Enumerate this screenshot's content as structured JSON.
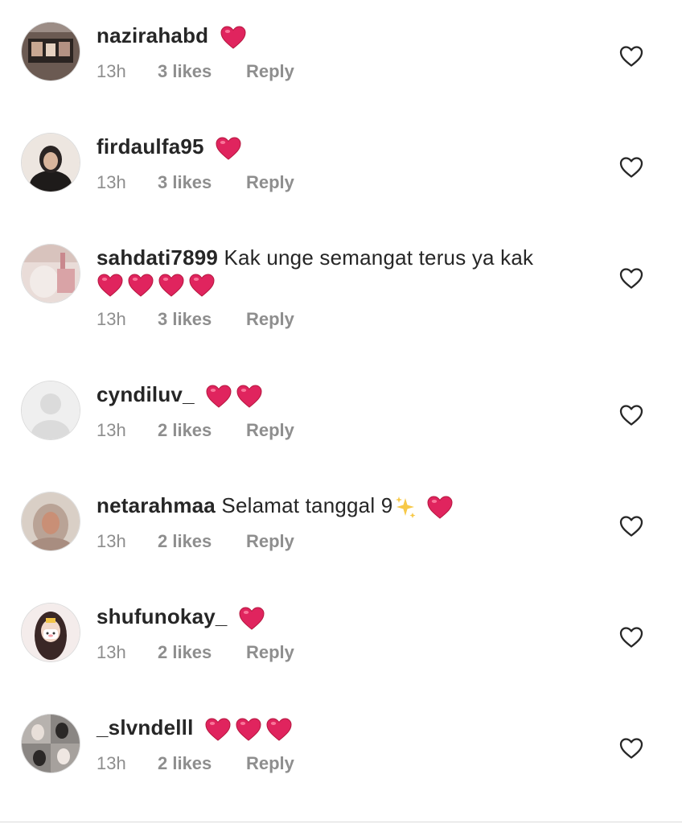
{
  "comments": [
    {
      "username": "nazirahabd",
      "text": "",
      "hearts": 1,
      "sparkle": false,
      "time": "13h",
      "likes": "3 likes",
      "reply": "Reply"
    },
    {
      "username": "firdaulfa95",
      "text": "",
      "hearts": 1,
      "sparkle": false,
      "time": "13h",
      "likes": "3 likes",
      "reply": "Reply"
    },
    {
      "username": "sahdati7899",
      "text": "Kak unge semangat terus ya kak",
      "hearts": 4,
      "sparkle": false,
      "time": "13h",
      "likes": "3 likes",
      "reply": "Reply"
    },
    {
      "username": "cyndiluv_",
      "text": "",
      "hearts": 2,
      "sparkle": false,
      "time": "13h",
      "likes": "2 likes",
      "reply": "Reply"
    },
    {
      "username": "netarahmaa",
      "text": "Selamat tanggal 9",
      "hearts": 1,
      "sparkle": true,
      "time": "13h",
      "likes": "2 likes",
      "reply": "Reply"
    },
    {
      "username": "shufunokay_",
      "text": "",
      "hearts": 1,
      "sparkle": false,
      "time": "13h",
      "likes": "2 likes",
      "reply": "Reply"
    },
    {
      "username": "_slvndelll",
      "text": "",
      "hearts": 3,
      "sparkle": false,
      "time": "13h",
      "likes": "2 likes",
      "reply": "Reply"
    }
  ],
  "icons": {
    "like": "heart-outline-icon",
    "emoji_heart": "red-heart-emoji",
    "emoji_sparkle": "sparkles-emoji"
  },
  "colors": {
    "text": "#262626",
    "meta": "#8e8e8e",
    "heart": "#e0245e"
  }
}
